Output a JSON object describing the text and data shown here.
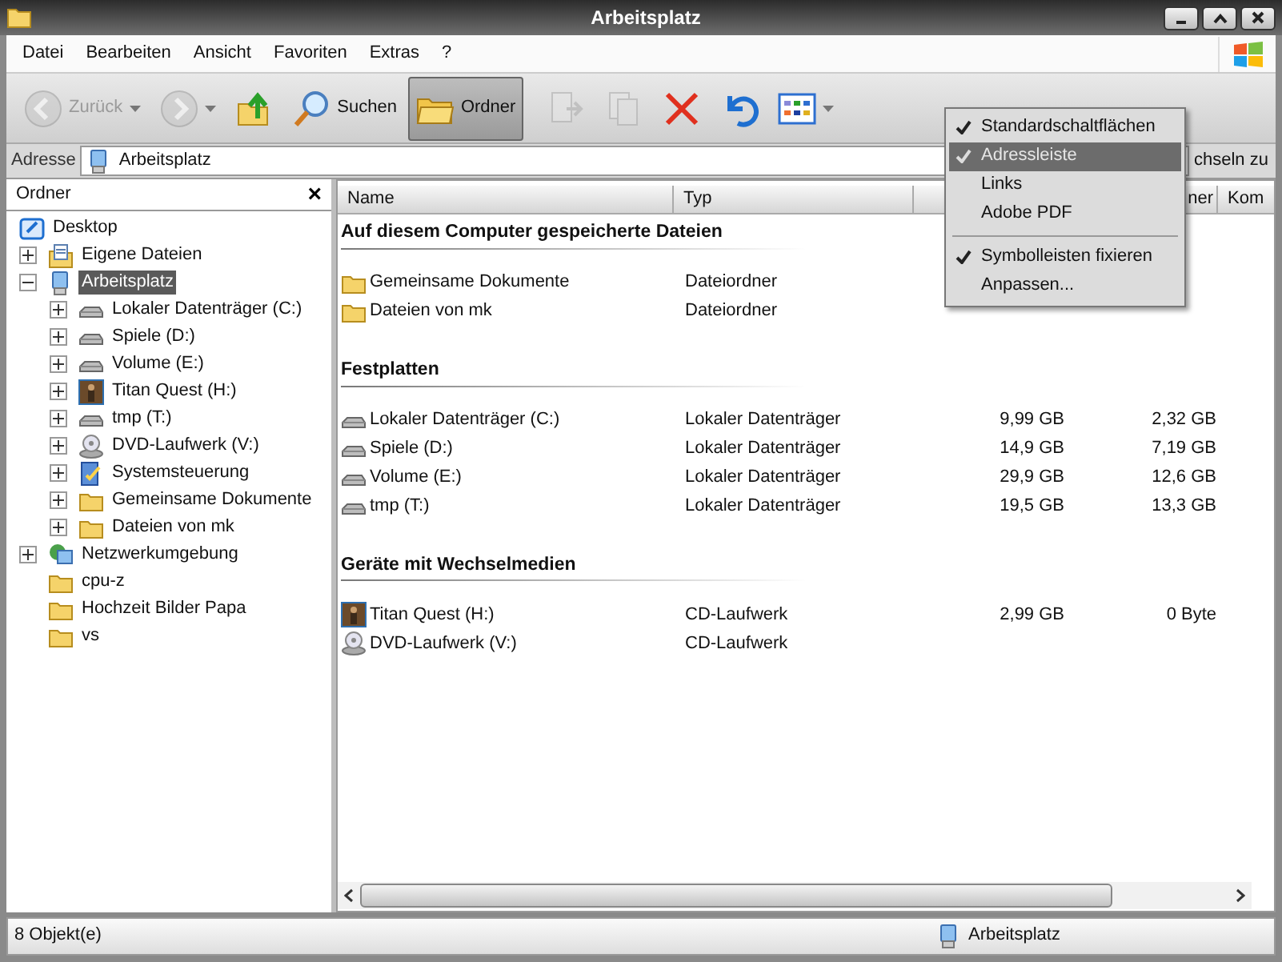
{
  "window": {
    "title": "Arbeitsplatz"
  },
  "menu_bar": [
    "Datei",
    "Bearbeiten",
    "Ansicht",
    "Favoriten",
    "Extras",
    "?"
  ],
  "toolbar": [
    {
      "kind": "back",
      "label": "Zurück",
      "disabled": true,
      "selected": false
    },
    {
      "kind": "forward",
      "disabled": true,
      "selected": false
    },
    {
      "kind": "up",
      "disabled": false,
      "selected": false
    },
    {
      "kind": "search",
      "label": "Suchen",
      "disabled": false,
      "selected": false
    },
    {
      "kind": "folders",
      "label": "Ordner",
      "disabled": false,
      "selected": true
    },
    {
      "kind": "move",
      "disabled": true,
      "selected": false
    },
    {
      "kind": "copy",
      "disabled": true,
      "selected": false
    },
    {
      "kind": "delete",
      "disabled": false,
      "selected": false
    },
    {
      "kind": "undo",
      "disabled": false,
      "selected": false
    },
    {
      "kind": "views",
      "disabled": false,
      "selected": false
    }
  ],
  "address": {
    "label": "Adresse",
    "value": "Arbeitsplatz",
    "go_label": "chseln zu"
  },
  "folder_pane": {
    "title": "Ordner",
    "close": "×"
  },
  "tree": [
    {
      "label": "Desktop",
      "kind": "desktop",
      "selected": false,
      "children": [
        {
          "label": "Eigene Dateien",
          "kind": "docs",
          "expanded": false,
          "selected": false
        },
        {
          "label": "Arbeitsplatz",
          "kind": "computer",
          "expanded": true,
          "selected": true,
          "children": [
            {
              "label": "Lokaler Datenträger (C:)",
              "kind": "drive",
              "expanded": false,
              "selected": false
            },
            {
              "label": "Spiele (D:)",
              "kind": "drive",
              "expanded": false,
              "selected": false
            },
            {
              "label": "Volume (E:)",
              "kind": "drive",
              "expanded": false,
              "selected": false
            },
            {
              "label": "Titan Quest (H:)",
              "kind": "game",
              "expanded": false,
              "selected": false
            },
            {
              "label": "tmp (T:)",
              "kind": "drive",
              "expanded": false,
              "selected": false
            },
            {
              "label": "DVD-Laufwerk (V:)",
              "kind": "dvd",
              "expanded": false,
              "selected": false
            },
            {
              "label": "Systemsteuerung",
              "kind": "control",
              "expanded": false,
              "selected": false
            },
            {
              "label": "Gemeinsame Dokumente",
              "kind": "folder",
              "expanded": false,
              "selected": false
            },
            {
              "label": "Dateien von mk",
              "kind": "folder",
              "expanded": false,
              "selected": false
            }
          ]
        },
        {
          "label": "Netzwerkumgebung",
          "kind": "network",
          "expanded": false,
          "selected": false
        },
        {
          "label": "cpu-z",
          "kind": "folder",
          "selected": false
        },
        {
          "label": "Hochzeit Bilder Papa",
          "kind": "folder",
          "selected": false
        },
        {
          "label": "vs",
          "kind": "folder",
          "selected": false
        }
      ]
    }
  ],
  "columns": [
    {
      "label": "Name"
    },
    {
      "label": "Typ"
    },
    {},
    {
      "label": "ner"
    },
    {
      "label": "Kom"
    }
  ],
  "groups": [
    {
      "title": "Auf diesem Computer gespeicherte Dateien",
      "rows": [
        {
          "kind": "folder",
          "name": "Gemeinsame Dokumente",
          "type": "Dateiordner"
        },
        {
          "kind": "folder",
          "name": "Dateien von mk",
          "type": "Dateiordner"
        }
      ]
    },
    {
      "title": "Festplatten",
      "rows": [
        {
          "kind": "drive",
          "name": "Lokaler Datenträger (C:)",
          "type": "Lokaler Datenträger",
          "total": "9,99 GB",
          "free": "2,32 GB"
        },
        {
          "kind": "drive",
          "name": "Spiele (D:)",
          "type": "Lokaler Datenträger",
          "total": "14,9 GB",
          "free": "7,19 GB"
        },
        {
          "kind": "drive",
          "name": "Volume (E:)",
          "type": "Lokaler Datenträger",
          "total": "29,9 GB",
          "free": "12,6 GB"
        },
        {
          "kind": "drive",
          "name": "tmp (T:)",
          "type": "Lokaler Datenträger",
          "total": "19,5 GB",
          "free": "13,3 GB"
        }
      ]
    },
    {
      "title": "Geräte mit Wechselmedien",
      "rows": [
        {
          "kind": "game",
          "name": "Titan Quest (H:)",
          "type": "CD-Laufwerk",
          "total": "2,99 GB",
          "free": "0 Byte"
        },
        {
          "kind": "dvd",
          "name": "DVD-Laufwerk (V:)",
          "type": "CD-Laufwerk"
        }
      ]
    }
  ],
  "context_menu": [
    {
      "kind": "item",
      "label": "Standardschaltflächen",
      "checked": true,
      "selected": false
    },
    {
      "kind": "item",
      "label": "Adressleiste",
      "checked": true,
      "selected": true
    },
    {
      "kind": "item",
      "label": "Links",
      "checked": false,
      "selected": false
    },
    {
      "kind": "item",
      "label": "Adobe PDF",
      "checked": false,
      "selected": false
    },
    {
      "kind": "separator"
    },
    {
      "kind": "item",
      "label": "Symbolleisten fixieren",
      "checked": true,
      "selected": false
    },
    {
      "kind": "item",
      "label": "Anpassen...",
      "checked": false,
      "selected": false
    }
  ],
  "status_bar": {
    "count": "8 Objekt(e)",
    "location": "Arbeitsplatz"
  }
}
